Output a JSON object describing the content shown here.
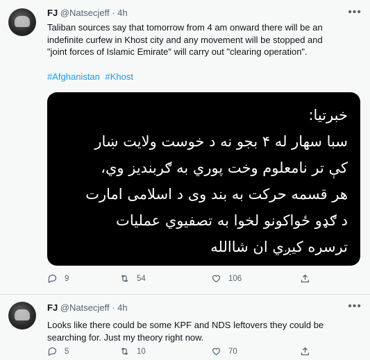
{
  "tweets": [
    {
      "name": "FJ",
      "handle": "@Natsecjeff",
      "dot": "·",
      "time": "4h",
      "text": "Taliban sources say that tomorrow from 4 am onward there will be an\nindefinite curfew in Khost city and any movement will be stopped and\n\"joint forces of Islamic Emirate\" will carry out \"clearing operation\".",
      "hashtags": [
        "#Afghanistan",
        "#Khost"
      ],
      "image_text": "خبرتیا:\nسبا سهار له ۴ بجو نه د خوست ولایت ښار\nکې تر نامعلوم وخت پوري به ګربندیز وي،\nهر قسمه حرکت به بند وی د اسلامی امارت\nد ګډو ځواکونو لخوا به تصفیوي عملیات\nترسره کیږي ان شاالله",
      "replies": "9",
      "retweets": "54",
      "likes": "106"
    },
    {
      "name": "FJ",
      "handle": "@Natsecjeff",
      "dot": "·",
      "time": "4h",
      "text": "Looks like there could be some KPF and NDS leftovers they could be\nsearching for. Just my theory right now.",
      "replies": "5",
      "retweets": "10",
      "likes": "70"
    }
  ],
  "icons": {
    "more": "more-icon",
    "reply": "reply-icon",
    "retweet": "retweet-icon",
    "like": "like-icon",
    "share": "share-icon"
  },
  "colors": {
    "background": "#f7f9f9",
    "link": "#1d9bf0",
    "secondary": "#536471",
    "media_bg": "#000000"
  }
}
